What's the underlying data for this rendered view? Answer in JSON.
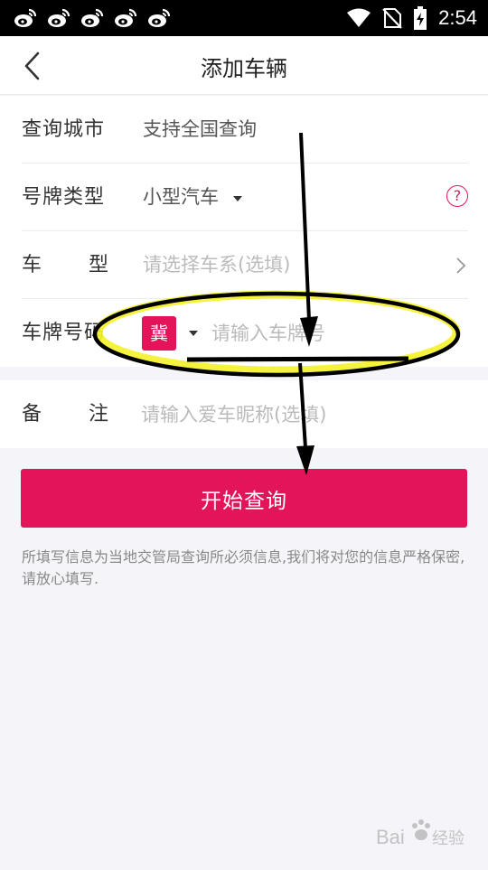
{
  "status_bar": {
    "time": "2:54",
    "notification_icons": [
      "weibo-icon",
      "weibo-icon",
      "weibo-icon",
      "weibo-icon",
      "weibo-icon"
    ],
    "system_icons": [
      "wifi-icon",
      "no-sim-icon",
      "battery-charging-icon"
    ]
  },
  "header": {
    "title": "添加车辆",
    "back_icon": "chevron-left-icon"
  },
  "form": {
    "city": {
      "label": "查询城市",
      "value": "支持全国查询"
    },
    "plate_type": {
      "label": "号牌类型",
      "value": "小型汽车",
      "help_glyph": "?"
    },
    "car_model": {
      "label_chars": [
        "车",
        "型"
      ],
      "placeholder": "请选择车系(选填)"
    },
    "plate_number": {
      "label": "车牌号码",
      "province": "冀",
      "placeholder": "请输入车牌号",
      "value": ""
    },
    "note": {
      "label_chars": [
        "备",
        "注"
      ],
      "placeholder": "请输入爱车昵称(选填)",
      "value": ""
    }
  },
  "submit_label": "开始查询",
  "privacy_note": "所填写信息为当地交管局查询所必须信息,我们将对您的信息严格保密,请放心填写.",
  "watermark": "Bai 经验",
  "colors": {
    "accent": "#e3145a",
    "placeholder": "#bbbbbb",
    "background": "#f5f4f9",
    "annotation_highlight": "#f5f22a",
    "annotation_stroke": "#000000"
  }
}
